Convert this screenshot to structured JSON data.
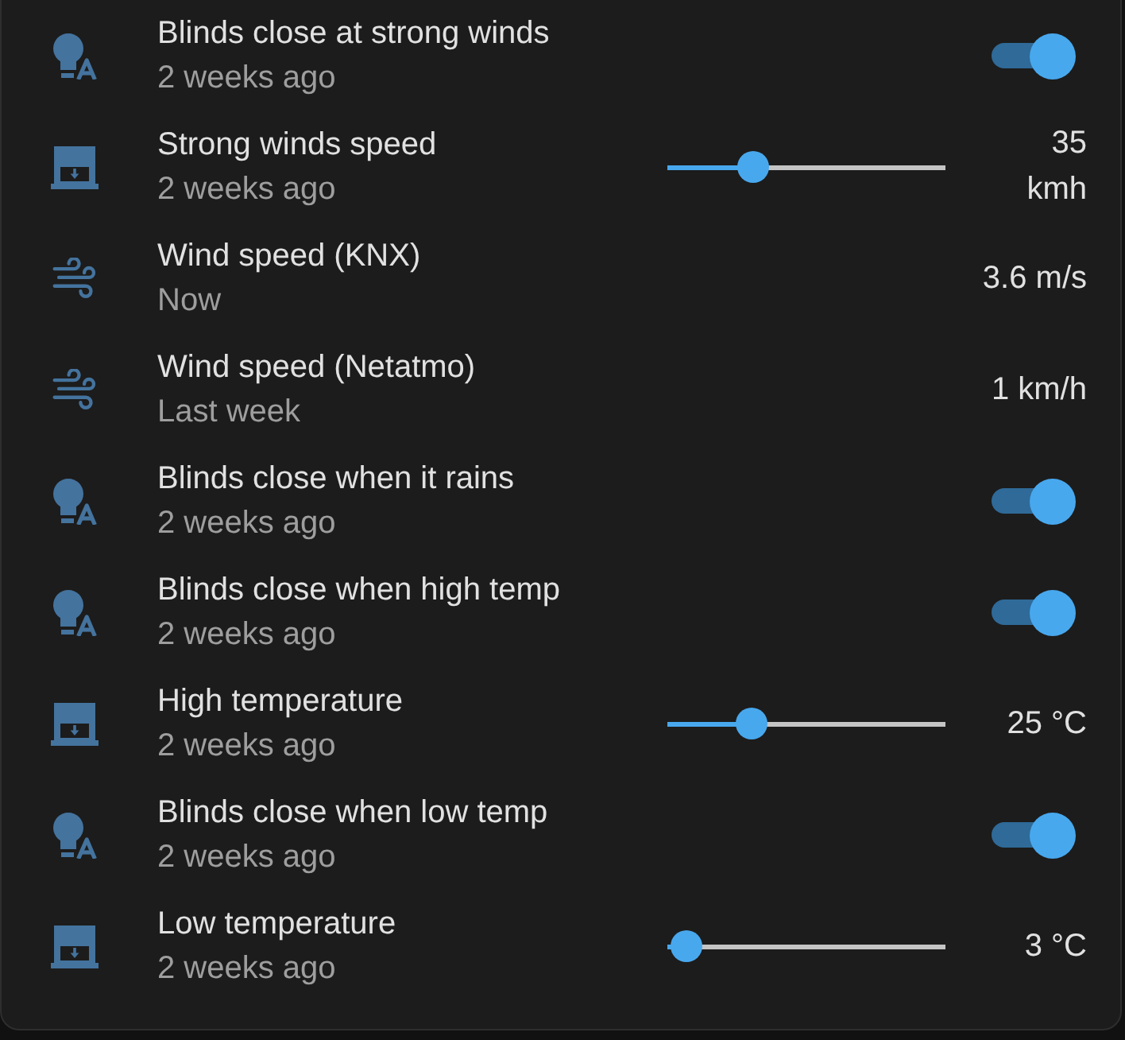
{
  "entities": [
    {
      "kind": "toggle",
      "name": "Blinds close at strong winds",
      "last_changed": "2 weeks ago",
      "on": true
    },
    {
      "kind": "slider",
      "name": "Strong winds speed",
      "last_changed": "2 weeks ago",
      "level": 0.31,
      "reading": "35 kmh"
    },
    {
      "kind": "sensor",
      "name": "Wind speed (KNX)",
      "last_changed": "Now",
      "reading": "3.6 m/s"
    },
    {
      "kind": "sensor",
      "name": "Wind speed (Netatmo)",
      "last_changed": "Last week",
      "reading": "1 km/h"
    },
    {
      "kind": "toggle",
      "name": "Blinds close when it rains",
      "last_changed": "2 weeks ago",
      "on": true
    },
    {
      "kind": "toggle",
      "name": "Blinds close when high temp",
      "last_changed": "2 weeks ago",
      "on": true
    },
    {
      "kind": "slider",
      "name": "High temperature",
      "last_changed": "2 weeks ago",
      "level": 0.3,
      "reading": "25 °C"
    },
    {
      "kind": "toggle",
      "name": "Blinds close when low temp",
      "last_changed": "2 weeks ago",
      "on": true
    },
    {
      "kind": "slider",
      "name": "Low temperature",
      "last_changed": "2 weeks ago",
      "level": 0.07,
      "reading": "3 °C"
    }
  ]
}
